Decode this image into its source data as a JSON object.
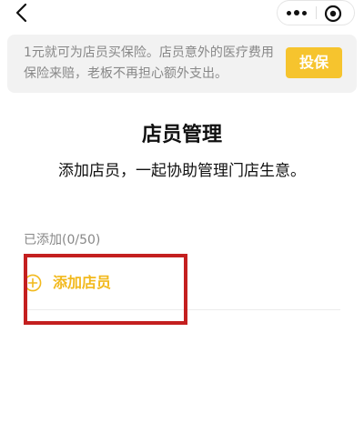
{
  "navbar": {
    "back_icon": "chevron-left-icon",
    "more_icon": "more-dots-icon",
    "close_icon": "target-circle-icon"
  },
  "banner": {
    "text": "1元就可为店员买保险。店员意外的医疗费用保险来赔，老板不再担心额外支出。",
    "button_label": "投保",
    "button_color": "#f6c42e"
  },
  "main": {
    "title": "店员管理",
    "subtitle": "添加店员，一起协助管理门店生意。",
    "added_count": "已添加(0/50)",
    "add_label": "添加店员",
    "add_icon": "plus-circle-icon",
    "accent_color": "#f2b91d"
  },
  "annotation": {
    "highlight_color": "#c41f1f"
  }
}
